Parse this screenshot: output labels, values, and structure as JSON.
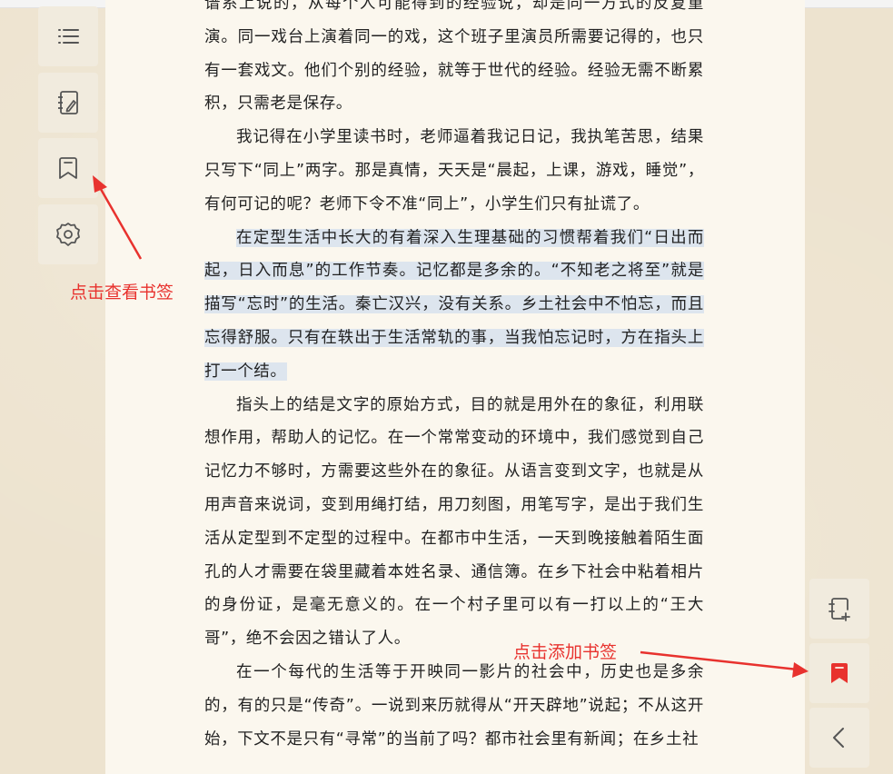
{
  "reader": {
    "paragraphs": [
      {
        "text": "谱系上说的，从每个人可能得到的经验说，却是同一方式的反复重演。同一戏台上演着同一的戏，这个班子里演员所需要记得的，也只有一套戏文。他们个别的经验，就等于世代的经验。经验无需不断累积，只需老是保存。",
        "indent": false
      },
      {
        "text": "我记得在小学里读书时，老师逼着我记日记，我执笔苦思，结果只写下“同上”两字。那是真情，天天是“晨起，上课，游戏，睡觉”，有何可记的呢？老师下令不准“同上”，小学生们只有扯谎了。",
        "indent": true
      },
      {
        "text": "在定型生活中长大的有着深入生理基础的习惯帮着我们“日出而起，日入而息”的工作节奏。记忆都是多余的。“不知老之将至”就是描写“忘时”的生活。秦亡汉兴，没有关系。乡土社会中不怕忘，而且忘得舒服。只有在轶出于生活常轨的事，当我怕忘记时，方在指头上打一个结。",
        "indent": true,
        "highlighted": true
      },
      {
        "text": "指头上的结是文字的原始方式，目的就是用外在的象征，利用联想作用，帮助人的记忆。在一个常常变动的环境中，我们感觉到自己记忆力不够时，方需要这些外在的象征。从语言变到文字，也就是从用声音来说词，变到用绳打结，用刀刻图，用笔写字，是出于我们生活从定型到不定型的过程中。在都市中生活，一天到晚接触着陌生面孔的人才需要在袋里藏着本姓名录、通信簿。在乡下社会中粘着相片的身份证，是毫无意义的。在一个村子里可以有一打以上的“王大哥”，绝不会因之错认了人。",
        "indent": true
      },
      {
        "text": "在一个每代的生活等于开映同一影片的社会中，历史也是多余的，有的只是“传奇”。一说到来历就得从“开天辟地”说起；不从这开始，下文不是只有“寻常”的当前了吗？都市社会里有新闻；在乡土社",
        "indent": true
      }
    ]
  },
  "annotations": {
    "view_bookmarks": "点击查看书签",
    "add_bookmark": "点击添加书签"
  },
  "icons": {
    "left": [
      "list-icon",
      "notebook-pen-icon",
      "bookmark-outline-icon",
      "gear-icon"
    ],
    "right": [
      "note-add-icon",
      "bookmark-filled-icon",
      "chevron-left-icon"
    ]
  },
  "colors": {
    "annotation": "#e8322e",
    "highlight": "#dde5ee",
    "page": "#fbf7ee",
    "background": "#ede3cf"
  }
}
